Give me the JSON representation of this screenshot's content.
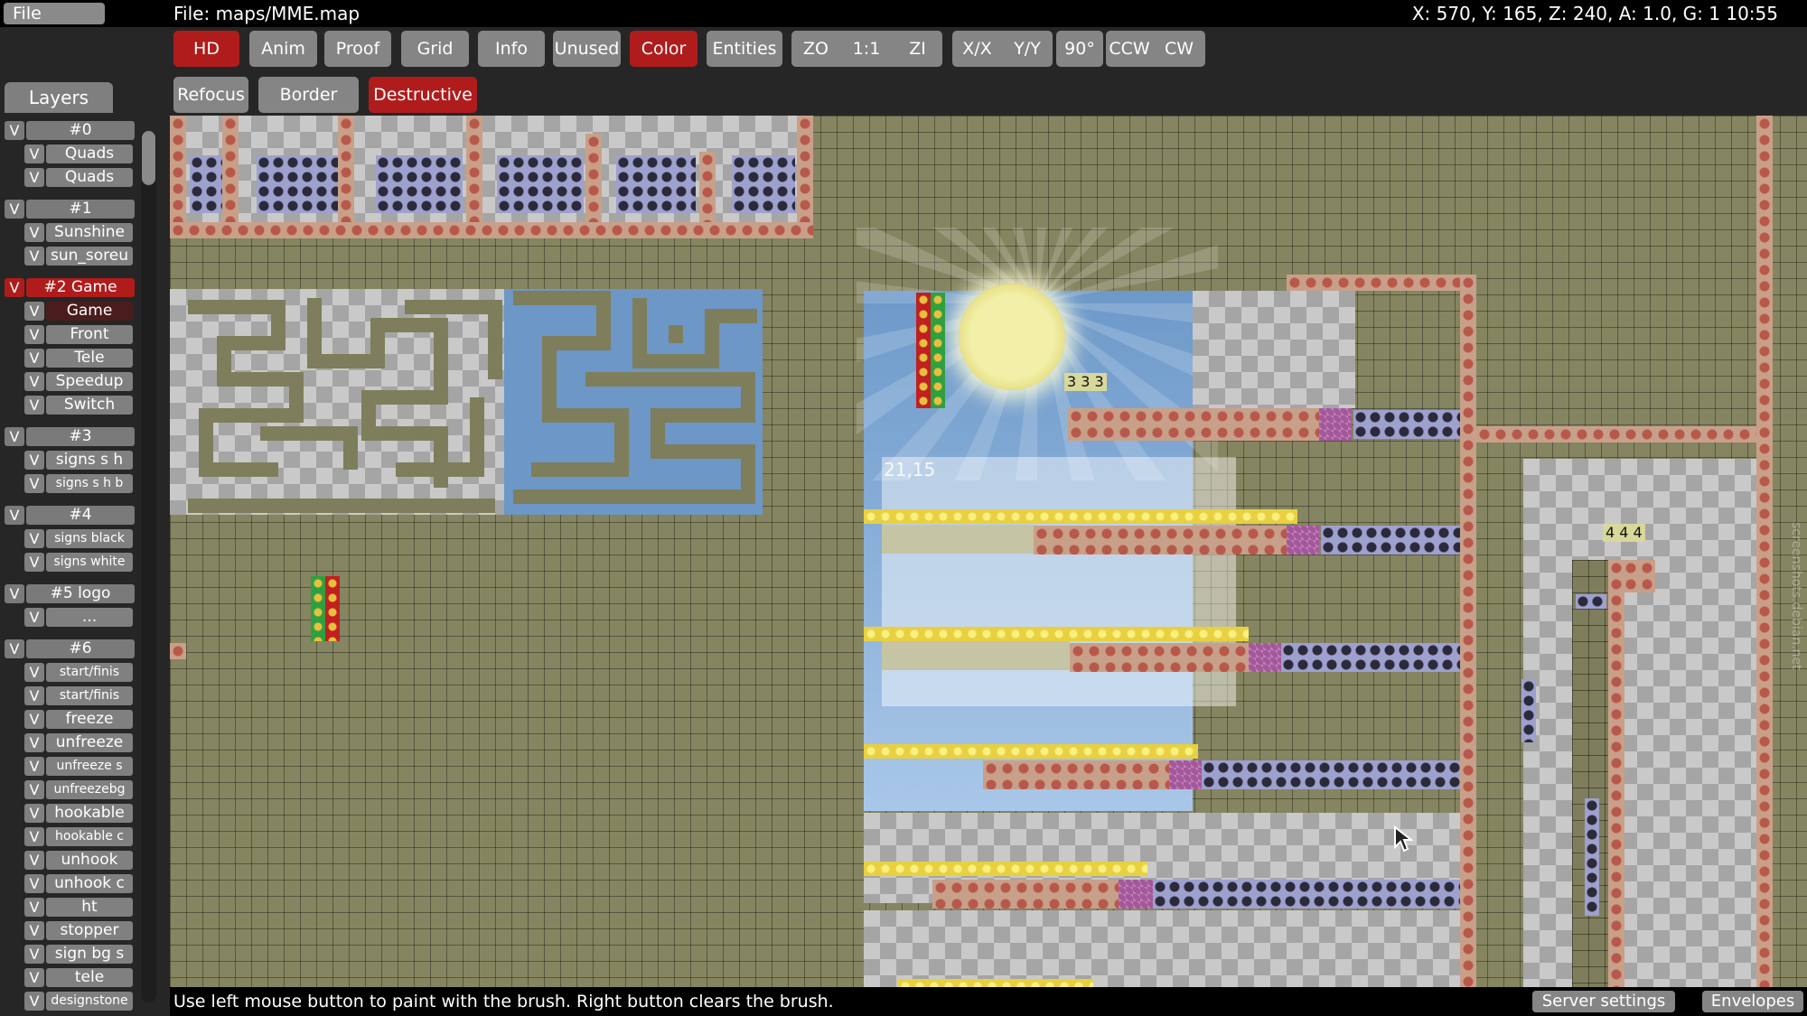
{
  "topbar": {
    "file_menu": "File",
    "file_title": "File: maps/MME.map",
    "status": "X: 570, Y: 165, Z: 240, A: 1.0, G: 1  10:55"
  },
  "toolbar": {
    "row1": {
      "hd": "HD",
      "anim": "Anim",
      "proof": "Proof",
      "grid": "Grid",
      "info": "Info",
      "unused": "Unused",
      "color": "Color",
      "entities": "Entities",
      "zoom_out": "ZO",
      "zoom_reset": "1:1",
      "zoom_in": "ZI",
      "flip_x": "X/X",
      "flip_y": "Y/Y",
      "rotate_90": "90°",
      "rotate_ccw": "CCW",
      "rotate_cw": "CW"
    },
    "row2": {
      "refocus": "Refocus",
      "border": "Border",
      "destructive": "Destructive"
    },
    "active": [
      "HD",
      "Color",
      "Destructive"
    ],
    "active_color": "#b01c1c"
  },
  "layers_panel": {
    "tab_label": "Layers",
    "visibility_label": "V",
    "groups": [
      {
        "name": "#0",
        "layers": [
          "Quads",
          "Quads"
        ]
      },
      {
        "name": "#1",
        "layers": [
          "Sunshine",
          "sun_soreu"
        ]
      },
      {
        "name": "#2 Game",
        "selected": true,
        "layers": [
          "Game",
          "Front",
          "Tele",
          "Speedup",
          "Switch"
        ]
      },
      {
        "name": "#3",
        "layers": [
          "signs s h",
          "signs s h b"
        ]
      },
      {
        "name": "#4",
        "layers": [
          "signs black",
          "signs white"
        ]
      },
      {
        "name": "#5 logo",
        "layers": [
          "..."
        ]
      },
      {
        "name": "#6",
        "layers": [
          "start/finis",
          "start/finis",
          "freeze",
          "unfreeze",
          "unfreeze s",
          "unfreezebg",
          "hookable",
          "hookable c",
          "unhook",
          "unhook c",
          "ht",
          "stopper",
          "sign bg s",
          "tele",
          "designstone"
        ]
      }
    ]
  },
  "canvas": {
    "labels": {
      "switch_label_1": "3 3 3",
      "switch_label_2": "4 4 4",
      "coordinates_label": "21,15"
    },
    "watermark": "screenshots.debian.net"
  },
  "bottombar": {
    "hint": "Use left mouse button to paint with the brush. Right button clears the brush.",
    "server_settings": "Server settings",
    "envelopes": "Envelopes"
  }
}
